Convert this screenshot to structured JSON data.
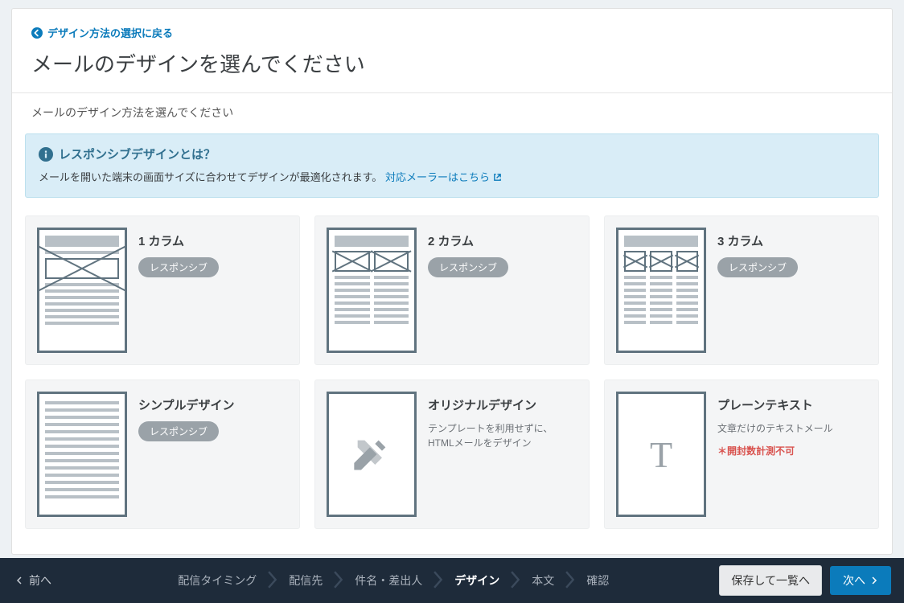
{
  "back_link": "デザイン方法の選択に戻る",
  "page_title": "メールのデザインを選んでください",
  "page_subtitle": "メールのデザイン方法を選んでください",
  "info": {
    "title": "レスポンシブデザインとは？",
    "desc": "メールを開いた端末の画面サイズに合わせてデザインが最適化されます。",
    "link_text": "対応メーラーはこちら"
  },
  "badge_label": "レスポンシブ",
  "cards": {
    "c1": {
      "name": "1 カラム"
    },
    "c2": {
      "name": "2 カラム"
    },
    "c3": {
      "name": "3 カラム"
    },
    "simple": {
      "name": "シンプルデザイン"
    },
    "original": {
      "name": "オリジナルデザイン",
      "desc": "テンプレートを利用せずに、HTMLメールをデザイン"
    },
    "plain": {
      "name": "プレーンテキスト",
      "desc": "文章だけのテキストメール",
      "warn": "＊開封数計測不可"
    }
  },
  "bottom": {
    "prev": "前へ",
    "steps": [
      "配信タイミング",
      "配信先",
      "件名・差出人",
      "デザイン",
      "本文",
      "確認"
    ],
    "active_index": 3,
    "save": "保存して一覧へ",
    "next": "次へ"
  }
}
